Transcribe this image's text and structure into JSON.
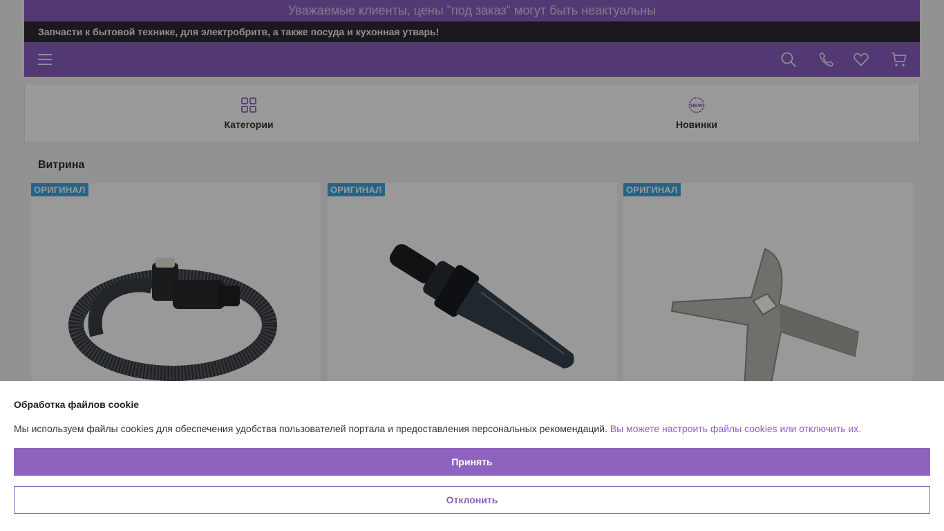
{
  "notice": {
    "text": "Уважаемые клиенты, цены \"под заказ\" могут быть неактуальны"
  },
  "subbar": {
    "text": "Запчасти к бытовой технике, для электробритв, а также посуда и кухонная утварь!"
  },
  "navbar": {
    "icons": [
      "menu-icon",
      "search-icon",
      "phone-icon",
      "heart-icon",
      "cart-icon"
    ]
  },
  "tabs": [
    {
      "label": "Категории",
      "icon": "grid-icon"
    },
    {
      "label": "Новинки",
      "icon": "new-badge-icon",
      "icon_text": "NEW"
    }
  ],
  "showcase": {
    "title": "Витрина",
    "products": [
      {
        "badge": "ОРИГИНАЛ",
        "image": "vacuum-hose"
      },
      {
        "badge": "ОРИГИНАЛ",
        "image": "handheld-vacuum-nozzle"
      },
      {
        "badge": "ОРИГИНАЛ",
        "image": "meat-grinder-blade"
      }
    ]
  },
  "cookie": {
    "title": "Обработка файлов cookie",
    "text": "Мы используем файлы cookies для обеспечения удобства пользователей портала и предоставления персональных рекомендаций.",
    "link": "Вы можете настроить файлы cookies или отключить их.",
    "accept": "Принять",
    "decline": "Отклонить"
  },
  "colors": {
    "brand": "#8a5fc0",
    "dark_bar": "#2e2a32",
    "badge": "#3da8df"
  }
}
